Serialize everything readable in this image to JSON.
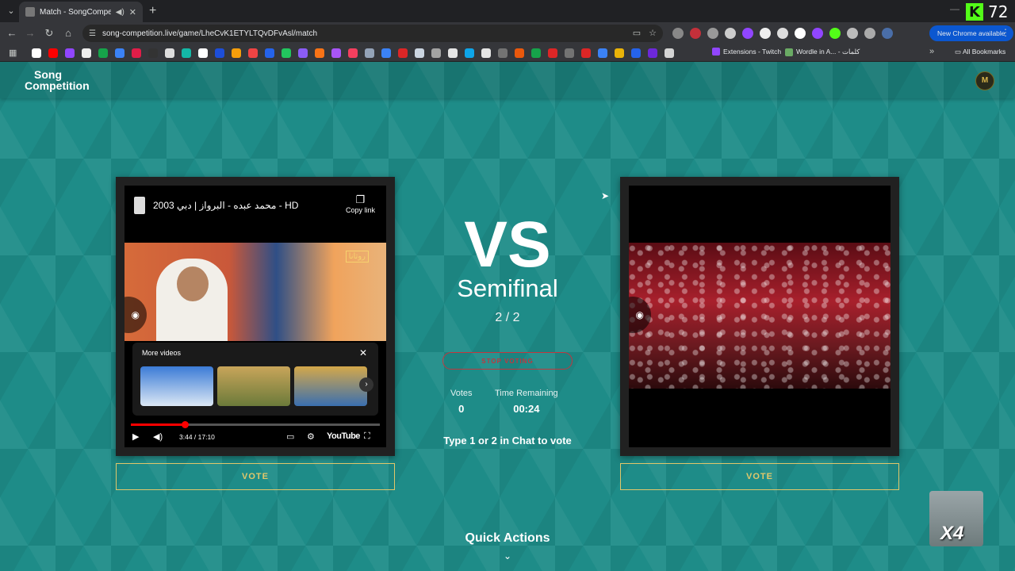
{
  "browser": {
    "tab_title": "Match - SongCompetition",
    "tab_audio_icon": "speaker-icon",
    "url": "song-competition.live/game/LheCvK1ETYLTQvDFvAsl/match",
    "new_chrome": "New Chrome available",
    "kick_count": "72",
    "bookmarks": {
      "extensions": "Extensions - Twitch",
      "wordle": "Wordle in A... - كلمات",
      "all": "All Bookmarks"
    }
  },
  "site": {
    "logo_line1": "Song",
    "logo_line2": "Competition",
    "avatar_text": "M"
  },
  "match": {
    "vs": "VS",
    "round": "Semifinal",
    "progress": "2 / 2",
    "stop_voting": "STOP VOTING",
    "votes_label": "Votes",
    "votes_value": "0",
    "time_label": "Time Remaining",
    "time_value": "00:24",
    "hint": "Type 1 or 2 in Chat to vote",
    "quick_actions": "Quick Actions"
  },
  "left_video": {
    "title": "محمد عبده - البرواز | دبي 2003 - HD",
    "copy_link": "Copy link",
    "more_videos": "More videos",
    "time": "3:44 / 17:10",
    "brand": "YouTube",
    "progress_fraction": 0.218,
    "channel_watermark": "روتانا"
  },
  "vote_left": "VOTE",
  "vote_right": "VOTE",
  "overlay_badge": "X4",
  "colors": {
    "page_bg": "#1b8a86",
    "vote_gold": "#e1c76a",
    "stop_red": "#c2363d"
  }
}
